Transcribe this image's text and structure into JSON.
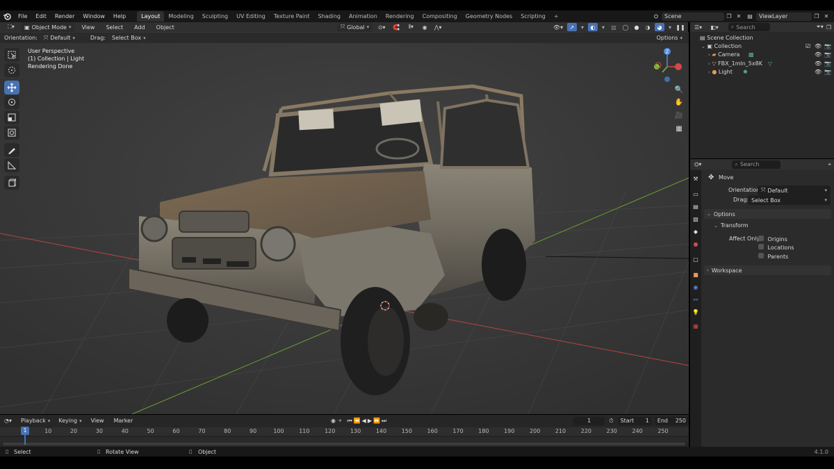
{
  "app": {
    "menus": [
      "File",
      "Edit",
      "Render",
      "Window",
      "Help"
    ],
    "workspaces": [
      "Layout",
      "Modeling",
      "Sculpting",
      "UV Editing",
      "Texture Paint",
      "Shading",
      "Animation",
      "Rendering",
      "Compositing",
      "Geometry Nodes",
      "Scripting"
    ],
    "active_workspace": "Layout",
    "scene": "Scene",
    "view_layer": "ViewLayer"
  },
  "viewport_header": {
    "mode": "Object Mode",
    "menus": [
      "View",
      "Select",
      "Add",
      "Object"
    ],
    "transform_orientation": "Global",
    "orientation_label": "Orientation:",
    "orientation_value": "Default",
    "drag_label": "Drag:",
    "drag_value": "Select Box",
    "options": "Options"
  },
  "viewport_overlay": {
    "line1": "User Perspective",
    "line2": "(1) Collection | Light",
    "line3": "Rendering Done"
  },
  "gizmo": {
    "z": "Z"
  },
  "outliner": {
    "search_placeholder": "Search",
    "scene_collection": "Scene Collection",
    "collection": "Collection",
    "items": [
      {
        "name": "Camera",
        "icon": "camera-icon",
        "color": "#e49a57"
      },
      {
        "name": "FBX_1mln_5x8K",
        "icon": "mesh-icon",
        "color": "#e49a57"
      },
      {
        "name": "Light",
        "icon": "light-icon",
        "color": "#e49a57"
      }
    ]
  },
  "properties": {
    "search_placeholder": "Search",
    "tool_name": "Move",
    "orientation_label": "Orientation",
    "orientation_value": "Default",
    "drag_label": "Drag:",
    "drag_value": "Select Box",
    "options_panel": "Options",
    "transform_panel": "Transform",
    "affect_only_label": "Affect Only",
    "affect_only": [
      "Origins",
      "Locations",
      "Parents"
    ],
    "workspace_panel": "Workspace"
  },
  "timeline": {
    "menus": [
      "Playback",
      "Keying",
      "View",
      "Marker"
    ],
    "current_frame": "1",
    "start_label": "Start",
    "start_value": "1",
    "end_label": "End",
    "end_value": "250",
    "ticks": [
      "1",
      "10",
      "20",
      "30",
      "40",
      "50",
      "60",
      "70",
      "80",
      "90",
      "100",
      "110",
      "120",
      "130",
      "140",
      "150",
      "160",
      "170",
      "180",
      "190",
      "200",
      "210",
      "220",
      "230",
      "240",
      "250"
    ]
  },
  "statusbar": {
    "select": "Select",
    "rotate": "Rotate View",
    "object": "Object",
    "version": "4.1.0"
  },
  "colors": {
    "accent": "#4772b3",
    "x_axis": "#d04a4a",
    "y_axis": "#7fbf3a",
    "z_axis": "#4d8de0"
  }
}
